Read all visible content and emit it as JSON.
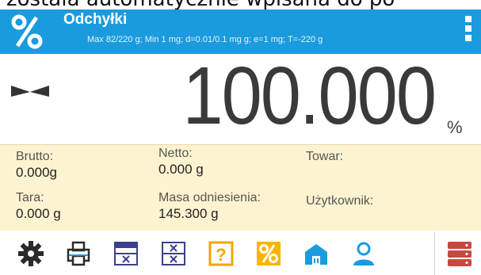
{
  "top_partial_text": "została automatycznie wpisana do po",
  "header": {
    "title": "Odchyłki",
    "specs": "Max 82/220 g; Min 1 mg; d=0.01/0.1 mg g; e=1 mg; T=-220 g",
    "mode_icon": "percent-icon",
    "menu_icon": "menu-dots-icon",
    "color": "#1a9bde"
  },
  "display": {
    "value": "100.000",
    "unit": "%",
    "stability_icon": "stable-indicator-icon"
  },
  "info": {
    "brutto_label": "Brutto:",
    "brutto_value": "0.000g",
    "netto_label": "Netto:",
    "netto_value": "0.000 g",
    "towar_label": "Towar:",
    "towar_value": "",
    "tara_label": "Tara:",
    "tara_value": "0.000 g",
    "masa_label": "Masa odniesienia:",
    "masa_value": "145.300 g",
    "user_label": "Użytkownik:",
    "user_value": "",
    "background": "#fdf3d0"
  },
  "toolbar": {
    "buttons": [
      "settings-icon",
      "print-icon",
      "database-calc-icon",
      "database-calc-alt-icon",
      "help-icon",
      "percent-icon",
      "warehouse-icon",
      "user-icon",
      "empty-slot",
      "server-icon"
    ]
  }
}
